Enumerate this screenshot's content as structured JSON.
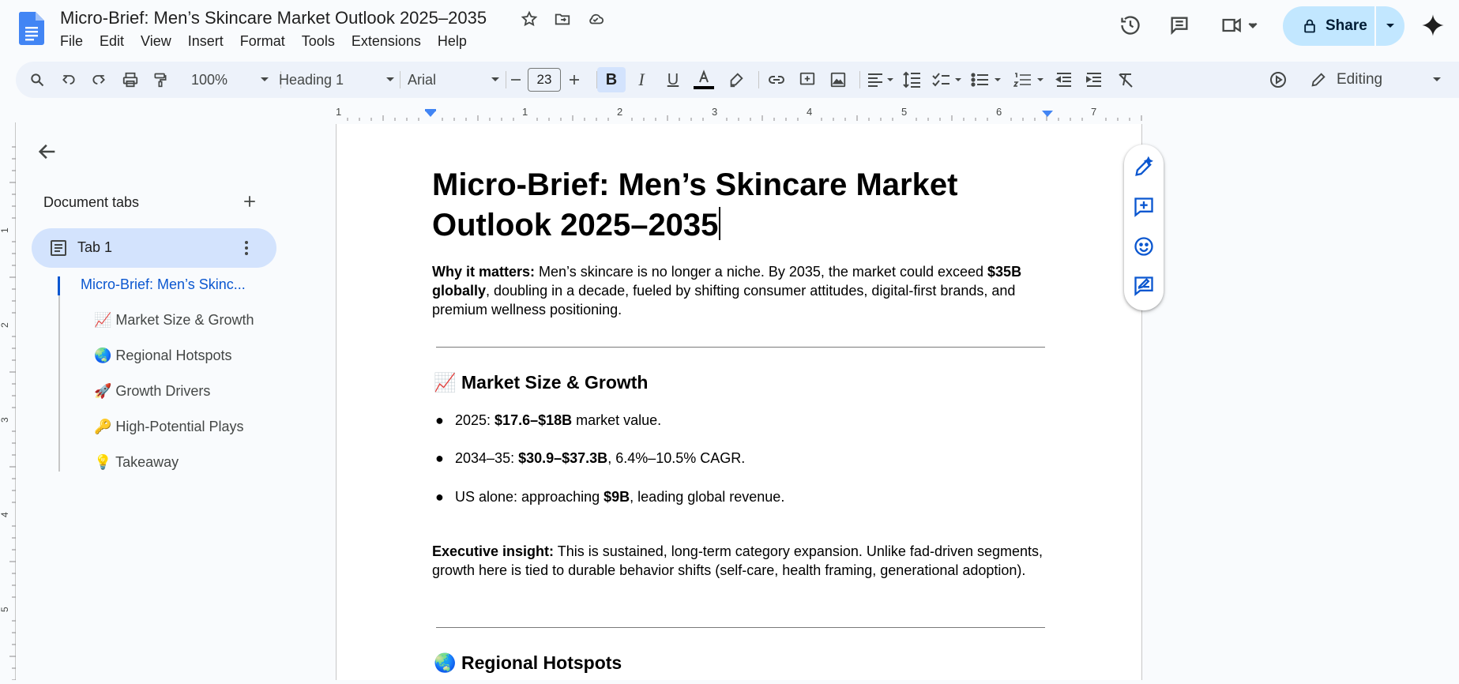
{
  "app": {
    "doc_title": "Micro-Brief: Men’s Skincare Market Outlook 2025–2035",
    "menus": [
      "File",
      "Edit",
      "View",
      "Insert",
      "Format",
      "Tools",
      "Extensions",
      "Help"
    ],
    "share_label": "Share",
    "accent": "#0b57d0"
  },
  "toolbar": {
    "zoom": "100%",
    "style": "Heading 1",
    "font": "Arial",
    "font_size": "23",
    "mode": "Editing"
  },
  "ruler": {
    "marks": [
      "1",
      "1",
      "2",
      "3",
      "4",
      "5",
      "6",
      "7"
    ],
    "vmarks": [
      "1",
      "2",
      "3",
      "4",
      "5"
    ]
  },
  "sidebar": {
    "heading": "Document tabs",
    "tab_label": "Tab 1",
    "outline": [
      {
        "label": "Micro-Brief: Men’s Skinc...",
        "active": true
      },
      {
        "label": "📈 Market Size & Growth"
      },
      {
        "label": "🌏 Regional Hotspots"
      },
      {
        "label": "🚀 Growth Drivers"
      },
      {
        "label": "🔑 High-Potential Plays"
      },
      {
        "label": "💡 Takeaway"
      }
    ]
  },
  "document": {
    "title_line1": "Micro-Brief: Men’s Skincare Market",
    "title_line2": "Outlook 2025–2035",
    "why": {
      "label": "Why it matters:",
      "text1": " Men’s skincare is no longer a niche. By 2035, the market could exceed ",
      "bold": "$35B globally",
      "text2": ", doubling in a decade, fueled by shifting consumer attitudes, digital-first brands, and premium wellness positioning."
    },
    "section1_title": "📈 Market Size & Growth",
    "bullets": [
      {
        "pre": "2025: ",
        "bold": "$17.6–$18B",
        "post": " market value."
      },
      {
        "pre": "2034–35: ",
        "bold": "$30.9–$37.3B",
        "post": ", 6.4%–10.5% CAGR."
      },
      {
        "pre": "US alone: approaching ",
        "bold": "$9B",
        "post": ", leading global revenue."
      }
    ],
    "insight": {
      "label": "Executive insight:",
      "text": " This is sustained, long-term category expansion. Unlike fad-driven segments, growth here is tied to durable behavior shifts (self-care, health framing, generational adoption)."
    },
    "section2_title": "🌏 Regional Hotspots"
  }
}
